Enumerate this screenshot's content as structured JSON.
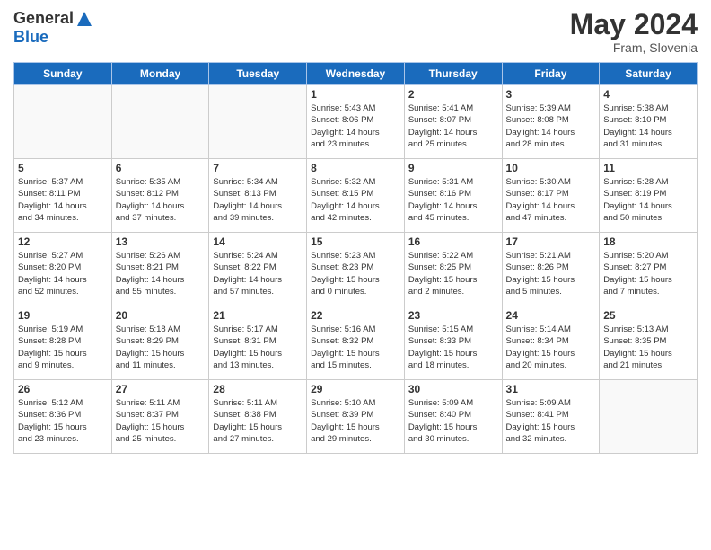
{
  "header": {
    "logo_general": "General",
    "logo_blue": "Blue",
    "month_year": "May 2024",
    "location": "Fram, Slovenia"
  },
  "weekdays": [
    "Sunday",
    "Monday",
    "Tuesday",
    "Wednesday",
    "Thursday",
    "Friday",
    "Saturday"
  ],
  "weeks": [
    [
      {
        "day": "",
        "info": ""
      },
      {
        "day": "",
        "info": ""
      },
      {
        "day": "",
        "info": ""
      },
      {
        "day": "1",
        "info": "Sunrise: 5:43 AM\nSunset: 8:06 PM\nDaylight: 14 hours\nand 23 minutes."
      },
      {
        "day": "2",
        "info": "Sunrise: 5:41 AM\nSunset: 8:07 PM\nDaylight: 14 hours\nand 25 minutes."
      },
      {
        "day": "3",
        "info": "Sunrise: 5:39 AM\nSunset: 8:08 PM\nDaylight: 14 hours\nand 28 minutes."
      },
      {
        "day": "4",
        "info": "Sunrise: 5:38 AM\nSunset: 8:10 PM\nDaylight: 14 hours\nand 31 minutes."
      }
    ],
    [
      {
        "day": "5",
        "info": "Sunrise: 5:37 AM\nSunset: 8:11 PM\nDaylight: 14 hours\nand 34 minutes."
      },
      {
        "day": "6",
        "info": "Sunrise: 5:35 AM\nSunset: 8:12 PM\nDaylight: 14 hours\nand 37 minutes."
      },
      {
        "day": "7",
        "info": "Sunrise: 5:34 AM\nSunset: 8:13 PM\nDaylight: 14 hours\nand 39 minutes."
      },
      {
        "day": "8",
        "info": "Sunrise: 5:32 AM\nSunset: 8:15 PM\nDaylight: 14 hours\nand 42 minutes."
      },
      {
        "day": "9",
        "info": "Sunrise: 5:31 AM\nSunset: 8:16 PM\nDaylight: 14 hours\nand 45 minutes."
      },
      {
        "day": "10",
        "info": "Sunrise: 5:30 AM\nSunset: 8:17 PM\nDaylight: 14 hours\nand 47 minutes."
      },
      {
        "day": "11",
        "info": "Sunrise: 5:28 AM\nSunset: 8:19 PM\nDaylight: 14 hours\nand 50 minutes."
      }
    ],
    [
      {
        "day": "12",
        "info": "Sunrise: 5:27 AM\nSunset: 8:20 PM\nDaylight: 14 hours\nand 52 minutes."
      },
      {
        "day": "13",
        "info": "Sunrise: 5:26 AM\nSunset: 8:21 PM\nDaylight: 14 hours\nand 55 minutes."
      },
      {
        "day": "14",
        "info": "Sunrise: 5:24 AM\nSunset: 8:22 PM\nDaylight: 14 hours\nand 57 minutes."
      },
      {
        "day": "15",
        "info": "Sunrise: 5:23 AM\nSunset: 8:23 PM\nDaylight: 15 hours\nand 0 minutes."
      },
      {
        "day": "16",
        "info": "Sunrise: 5:22 AM\nSunset: 8:25 PM\nDaylight: 15 hours\nand 2 minutes."
      },
      {
        "day": "17",
        "info": "Sunrise: 5:21 AM\nSunset: 8:26 PM\nDaylight: 15 hours\nand 5 minutes."
      },
      {
        "day": "18",
        "info": "Sunrise: 5:20 AM\nSunset: 8:27 PM\nDaylight: 15 hours\nand 7 minutes."
      }
    ],
    [
      {
        "day": "19",
        "info": "Sunrise: 5:19 AM\nSunset: 8:28 PM\nDaylight: 15 hours\nand 9 minutes."
      },
      {
        "day": "20",
        "info": "Sunrise: 5:18 AM\nSunset: 8:29 PM\nDaylight: 15 hours\nand 11 minutes."
      },
      {
        "day": "21",
        "info": "Sunrise: 5:17 AM\nSunset: 8:31 PM\nDaylight: 15 hours\nand 13 minutes."
      },
      {
        "day": "22",
        "info": "Sunrise: 5:16 AM\nSunset: 8:32 PM\nDaylight: 15 hours\nand 15 minutes."
      },
      {
        "day": "23",
        "info": "Sunrise: 5:15 AM\nSunset: 8:33 PM\nDaylight: 15 hours\nand 18 minutes."
      },
      {
        "day": "24",
        "info": "Sunrise: 5:14 AM\nSunset: 8:34 PM\nDaylight: 15 hours\nand 20 minutes."
      },
      {
        "day": "25",
        "info": "Sunrise: 5:13 AM\nSunset: 8:35 PM\nDaylight: 15 hours\nand 21 minutes."
      }
    ],
    [
      {
        "day": "26",
        "info": "Sunrise: 5:12 AM\nSunset: 8:36 PM\nDaylight: 15 hours\nand 23 minutes."
      },
      {
        "day": "27",
        "info": "Sunrise: 5:11 AM\nSunset: 8:37 PM\nDaylight: 15 hours\nand 25 minutes."
      },
      {
        "day": "28",
        "info": "Sunrise: 5:11 AM\nSunset: 8:38 PM\nDaylight: 15 hours\nand 27 minutes."
      },
      {
        "day": "29",
        "info": "Sunrise: 5:10 AM\nSunset: 8:39 PM\nDaylight: 15 hours\nand 29 minutes."
      },
      {
        "day": "30",
        "info": "Sunrise: 5:09 AM\nSunset: 8:40 PM\nDaylight: 15 hours\nand 30 minutes."
      },
      {
        "day": "31",
        "info": "Sunrise: 5:09 AM\nSunset: 8:41 PM\nDaylight: 15 hours\nand 32 minutes."
      },
      {
        "day": "",
        "info": ""
      }
    ]
  ]
}
